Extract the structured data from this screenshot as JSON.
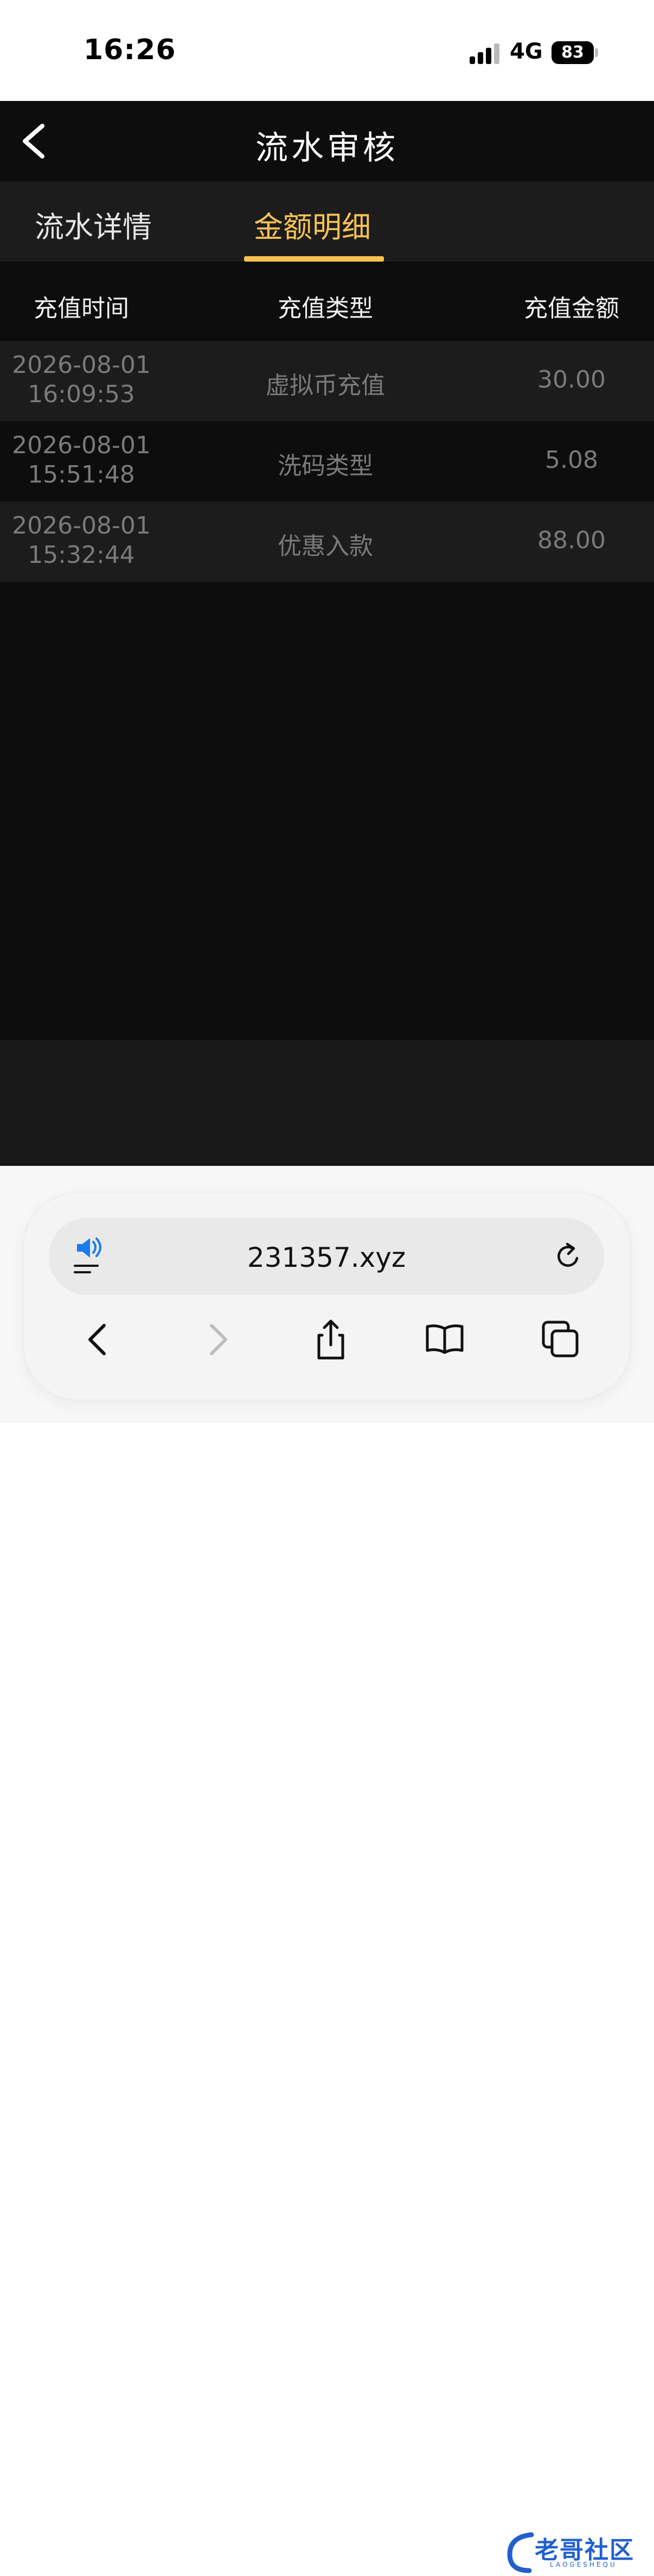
{
  "status_bar": {
    "time": "16:26",
    "network": "4G",
    "battery": "83"
  },
  "header": {
    "title": "流水审核"
  },
  "tabs": [
    {
      "label": "流水详情",
      "active": false
    },
    {
      "label": "金额明细",
      "active": true
    }
  ],
  "table": {
    "columns": [
      "充值时间",
      "充值类型",
      "充值金额"
    ],
    "rows": [
      {
        "date": "2026-08-01",
        "time": "16:09:53",
        "type": "虚拟币充值",
        "amount": "30.00"
      },
      {
        "date": "2026-08-01",
        "time": "15:51:48",
        "type": "洗码类型",
        "amount": "5.08"
      },
      {
        "date": "2026-08-01",
        "time": "15:32:44",
        "type": "优惠入款",
        "amount": "88.00"
      }
    ]
  },
  "browser": {
    "url": "231357.xyz"
  },
  "watermark": {
    "text": "老哥社区",
    "sub": "LAOGESHEQU"
  },
  "colors": {
    "accent": "#f7c255",
    "header_bg": "#0d0d0d",
    "row_alt_bg": "#1c1c1c",
    "cell_text": "#7a7a7a"
  }
}
